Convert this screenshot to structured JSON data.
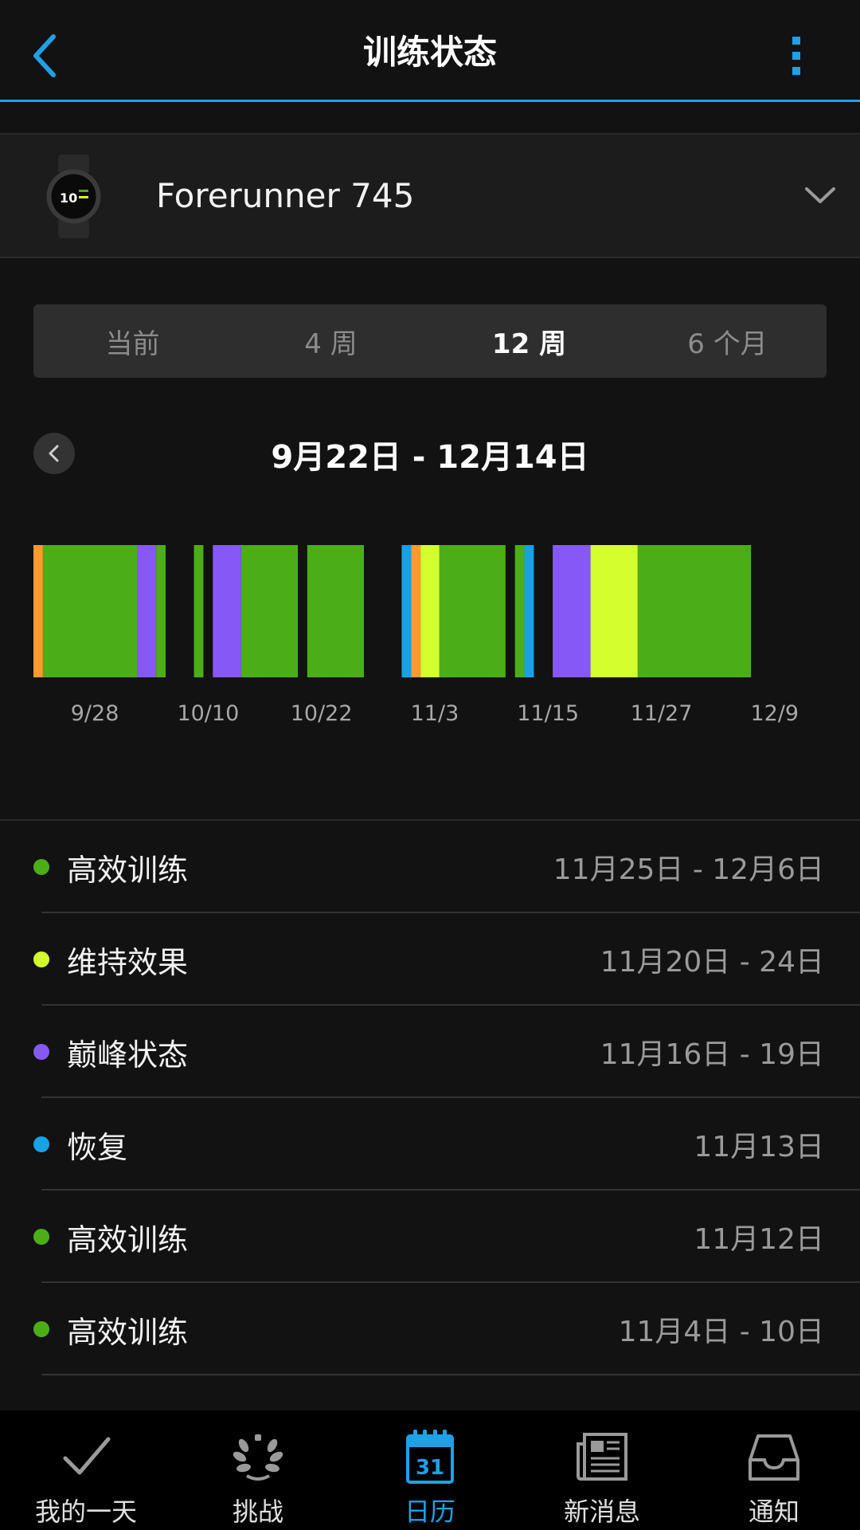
{
  "header": {
    "title": "训练状态"
  },
  "device": {
    "name": "Forerunner 745",
    "watch_time": "10"
  },
  "tabs": [
    {
      "label": "当前",
      "active": false
    },
    {
      "label": "4 周",
      "active": false
    },
    {
      "label": "12 周",
      "active": true
    },
    {
      "label": "6 个月",
      "active": false
    }
  ],
  "range": {
    "title": "9月22日 - 12月14日"
  },
  "colors": {
    "accent": "#1ea1e6",
    "productive": "#4cae16",
    "maintaining": "#d4ff2e",
    "peaking": "#8658f6",
    "recovery": "#16a2e4",
    "unproductive": "#ff9a2e"
  },
  "chart_data": {
    "type": "bar",
    "x_start": "9/22",
    "x_end": "12/14",
    "x_ticks": [
      "9/28",
      "10/10",
      "10/22",
      "11/3",
      "11/15",
      "11/27",
      "12/9"
    ],
    "segments": [
      {
        "start": "9/22",
        "end": "9/22",
        "status": "unproductive"
      },
      {
        "start": "9/23",
        "end": "10/2",
        "status": "productive"
      },
      {
        "start": "10/3",
        "end": "10/4",
        "status": "peaking"
      },
      {
        "start": "10/5",
        "end": "10/5",
        "status": "productive"
      },
      {
        "start": "10/9",
        "end": "10/9",
        "status": "productive"
      },
      {
        "start": "10/11",
        "end": "10/13",
        "status": "peaking"
      },
      {
        "start": "10/14",
        "end": "10/19",
        "status": "productive"
      },
      {
        "start": "10/21",
        "end": "10/26",
        "status": "productive"
      },
      {
        "start": "10/31",
        "end": "10/31",
        "status": "recovery"
      },
      {
        "start": "11/1",
        "end": "11/1",
        "status": "unproductive"
      },
      {
        "start": "11/2",
        "end": "11/3",
        "status": "maintaining"
      },
      {
        "start": "11/4",
        "end": "11/10",
        "status": "productive"
      },
      {
        "start": "11/12",
        "end": "11/12",
        "status": "productive"
      },
      {
        "start": "11/13",
        "end": "11/13",
        "status": "recovery"
      },
      {
        "start": "11/16",
        "end": "11/19",
        "status": "peaking"
      },
      {
        "start": "11/20",
        "end": "11/24",
        "status": "maintaining"
      },
      {
        "start": "11/25",
        "end": "12/6",
        "status": "productive"
      }
    ]
  },
  "list": [
    {
      "label": "高效训练",
      "date": "11月25日 - 12月6日",
      "status": "productive"
    },
    {
      "label": "维持效果",
      "date": "11月20日 - 24日",
      "status": "maintaining"
    },
    {
      "label": "巅峰状态",
      "date": "11月16日 - 19日",
      "status": "peaking"
    },
    {
      "label": "恢复",
      "date": "11月13日",
      "status": "recovery"
    },
    {
      "label": "高效训练",
      "date": "11月12日",
      "status": "productive"
    },
    {
      "label": "高效训练",
      "date": "11月4日 - 10日",
      "status": "productive"
    }
  ],
  "bottom_nav": [
    {
      "label": "我的一天",
      "icon": "checkmark-icon",
      "active": false
    },
    {
      "label": "挑战",
      "icon": "laurel-icon",
      "active": false
    },
    {
      "label": "日历",
      "icon": "calendar-icon",
      "active": true,
      "calendar_day": "31"
    },
    {
      "label": "新消息",
      "icon": "newspaper-icon",
      "active": false
    },
    {
      "label": "通知",
      "icon": "inbox-icon",
      "active": false
    }
  ]
}
